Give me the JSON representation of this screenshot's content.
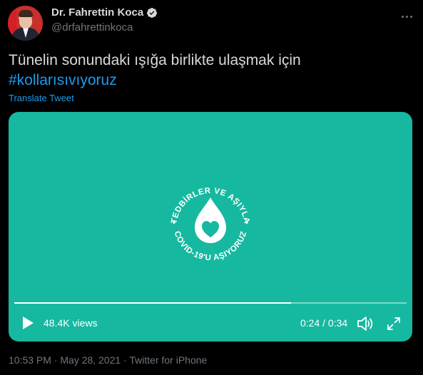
{
  "author": {
    "name": "Dr. Fahrettin Koca",
    "handle": "@drfahrettinkoca"
  },
  "tweet": {
    "text": "Tünelin sonundaki ışığa birlikte ulaşmak için",
    "hashtag": "#kollarısıvıyoruz",
    "translate_label": "Translate Tweet"
  },
  "video": {
    "logo_text_top": "TEDBİRLER VE AŞIYLA",
    "logo_text_bottom": "COVID-19'U AŞIYORUZ",
    "views": "48.4K views",
    "time": "0:24 / 0:34",
    "progress": 0.706,
    "background_color": "#16b8a0"
  },
  "meta": {
    "timestamp": "10:53 PM · May 28, 2021 · Twitter for iPhone"
  },
  "colors": {
    "link": "#1d9bf0",
    "secondary_text": "#6e767d",
    "primary_text": "#d9d9d9"
  },
  "icons": [
    "verified-badge-icon",
    "more-options-icon",
    "play-icon",
    "volume-icon",
    "fullscreen-icon"
  ]
}
